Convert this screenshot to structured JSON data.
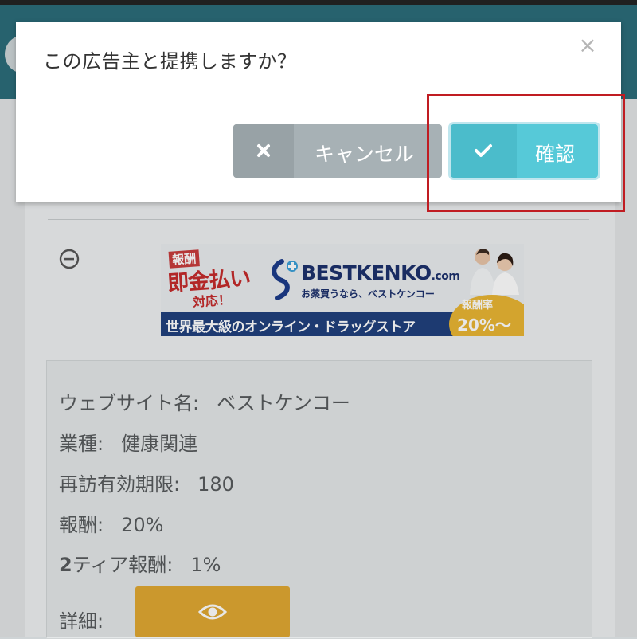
{
  "modal": {
    "title": "この広告主と提携しますか？",
    "close_label": "×",
    "cancel_label": "キャンセル",
    "confirm_label": "確認"
  },
  "banner": {
    "badge_line1": "報酬",
    "badge_line2": "即金払い",
    "badge_line3": "対応！",
    "brand": "BESTKENKO",
    "brand_suffix": ".com",
    "tagline": "お薬買うなら、ベストケンコー",
    "ribbon": "世界最大級のオンライン・ドラッグストア",
    "rate_label": "報酬率",
    "rate_value": "20%〜"
  },
  "details": {
    "website_label": "ウェブサイト名:",
    "website_value": "ベストケンコー",
    "industry_label": "業種:",
    "industry_value": "健康関連",
    "revisit_label": "再訪有効期限:",
    "revisit_value": "180",
    "reward_label": "報酬:",
    "reward_value": "20%",
    "tier_label_bold": "2",
    "tier_label": "ティア報酬:",
    "tier_value": "1%",
    "detail_label": "詳細:"
  },
  "colors": {
    "highlight": "#c01c22",
    "confirm": "#56c9d8",
    "cancel": "#a7b1b5",
    "view_button": "#e0a830"
  },
  "icons": {
    "cancel": "close-icon",
    "confirm": "check-icon",
    "collapse": "minus-circle-icon",
    "view": "eye-icon"
  }
}
